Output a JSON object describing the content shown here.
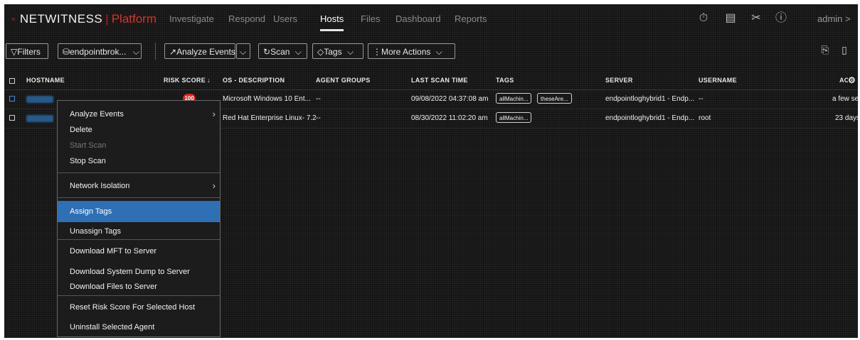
{
  "app": {
    "brand": "NETWITNESS",
    "platform": "Platform"
  },
  "nav": {
    "items": [
      "Investigate",
      "Respond",
      "Users",
      "Hosts",
      "Files",
      "Dashboard",
      "Reports"
    ],
    "active": "Hosts",
    "user": "admin >"
  },
  "toolbar": {
    "filters": "Filters",
    "service": "endpointbrok...",
    "analyze_events": "Analyze Events",
    "scan": "Scan",
    "tags": "Tags",
    "more_actions": "More Actions"
  },
  "table": {
    "columns": [
      "HOSTNAME",
      "RISK SCORE",
      "OS - DESCRIPTION",
      "AGENT GROUPS",
      "LAST SCAN TIME",
      "TAGS",
      "SERVER",
      "USERNAME",
      "AC"
    ],
    "rows": [
      {
        "risk": "100",
        "os": "Microsoft Windows 10 Ent...",
        "agent_groups": "--",
        "last_scan": "09/08/2022 04:37:08 am",
        "tags": [
          "allMachin...",
          "theseAre..."
        ],
        "server": "endpointloghybrid1 - Endp...",
        "username": "--",
        "ac": "a few se"
      },
      {
        "risk": "",
        "os": "Red Hat Enterprise Linux- 7.2",
        "agent_groups": "--",
        "last_scan": "08/30/2022 11:02:20 am",
        "tags": [
          "allMachin..."
        ],
        "server": "endpointloghybrid1 - Endp...",
        "username": "root",
        "ac": "23 days"
      }
    ]
  },
  "context_menu": {
    "items": [
      "Analyze Events",
      "Delete",
      "Start Scan",
      "Stop Scan",
      "Network Isolation",
      "Assign Tags",
      "Unassign Tags",
      "Download MFT to Server",
      "Download System Dump to Server",
      "Download Files to Server",
      "Reset Risk Score For Selected Host",
      "Uninstall Selected Agent"
    ],
    "selected": "Assign Tags",
    "disabled": [
      "Start Scan"
    ]
  },
  "colors": {
    "accent": "#2f6fb3",
    "brand_red": "#d9322c",
    "risk_red": "#e02020",
    "background": "#141414"
  }
}
